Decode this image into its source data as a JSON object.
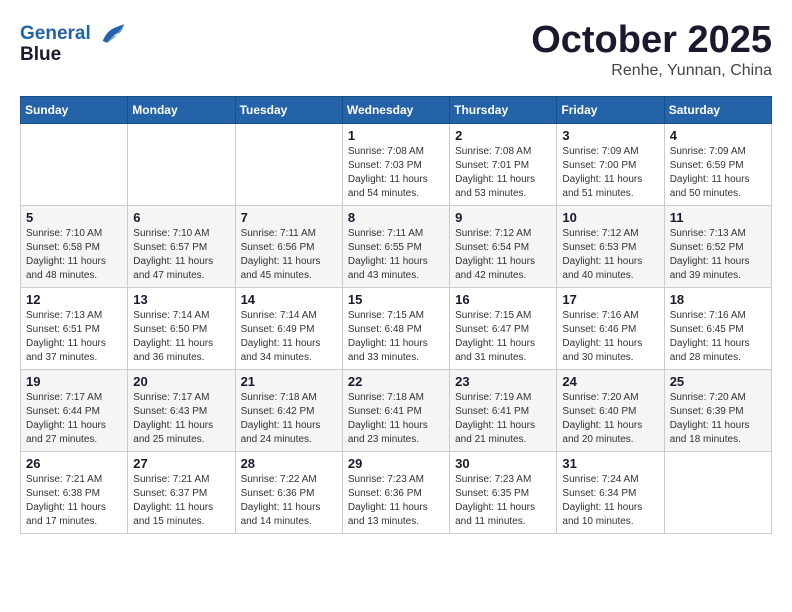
{
  "logo": {
    "line1": "General",
    "line2": "Blue"
  },
  "title": "October 2025",
  "subtitle": "Renhe, Yunnan, China",
  "weekdays": [
    "Sunday",
    "Monday",
    "Tuesday",
    "Wednesday",
    "Thursday",
    "Friday",
    "Saturday"
  ],
  "weeks": [
    [
      {
        "day": "",
        "info": ""
      },
      {
        "day": "",
        "info": ""
      },
      {
        "day": "",
        "info": ""
      },
      {
        "day": "1",
        "info": "Sunrise: 7:08 AM\nSunset: 7:03 PM\nDaylight: 11 hours\nand 54 minutes."
      },
      {
        "day": "2",
        "info": "Sunrise: 7:08 AM\nSunset: 7:01 PM\nDaylight: 11 hours\nand 53 minutes."
      },
      {
        "day": "3",
        "info": "Sunrise: 7:09 AM\nSunset: 7:00 PM\nDaylight: 11 hours\nand 51 minutes."
      },
      {
        "day": "4",
        "info": "Sunrise: 7:09 AM\nSunset: 6:59 PM\nDaylight: 11 hours\nand 50 minutes."
      }
    ],
    [
      {
        "day": "5",
        "info": "Sunrise: 7:10 AM\nSunset: 6:58 PM\nDaylight: 11 hours\nand 48 minutes."
      },
      {
        "day": "6",
        "info": "Sunrise: 7:10 AM\nSunset: 6:57 PM\nDaylight: 11 hours\nand 47 minutes."
      },
      {
        "day": "7",
        "info": "Sunrise: 7:11 AM\nSunset: 6:56 PM\nDaylight: 11 hours\nand 45 minutes."
      },
      {
        "day": "8",
        "info": "Sunrise: 7:11 AM\nSunset: 6:55 PM\nDaylight: 11 hours\nand 43 minutes."
      },
      {
        "day": "9",
        "info": "Sunrise: 7:12 AM\nSunset: 6:54 PM\nDaylight: 11 hours\nand 42 minutes."
      },
      {
        "day": "10",
        "info": "Sunrise: 7:12 AM\nSunset: 6:53 PM\nDaylight: 11 hours\nand 40 minutes."
      },
      {
        "day": "11",
        "info": "Sunrise: 7:13 AM\nSunset: 6:52 PM\nDaylight: 11 hours\nand 39 minutes."
      }
    ],
    [
      {
        "day": "12",
        "info": "Sunrise: 7:13 AM\nSunset: 6:51 PM\nDaylight: 11 hours\nand 37 minutes."
      },
      {
        "day": "13",
        "info": "Sunrise: 7:14 AM\nSunset: 6:50 PM\nDaylight: 11 hours\nand 36 minutes."
      },
      {
        "day": "14",
        "info": "Sunrise: 7:14 AM\nSunset: 6:49 PM\nDaylight: 11 hours\nand 34 minutes."
      },
      {
        "day": "15",
        "info": "Sunrise: 7:15 AM\nSunset: 6:48 PM\nDaylight: 11 hours\nand 33 minutes."
      },
      {
        "day": "16",
        "info": "Sunrise: 7:15 AM\nSunset: 6:47 PM\nDaylight: 11 hours\nand 31 minutes."
      },
      {
        "day": "17",
        "info": "Sunrise: 7:16 AM\nSunset: 6:46 PM\nDaylight: 11 hours\nand 30 minutes."
      },
      {
        "day": "18",
        "info": "Sunrise: 7:16 AM\nSunset: 6:45 PM\nDaylight: 11 hours\nand 28 minutes."
      }
    ],
    [
      {
        "day": "19",
        "info": "Sunrise: 7:17 AM\nSunset: 6:44 PM\nDaylight: 11 hours\nand 27 minutes."
      },
      {
        "day": "20",
        "info": "Sunrise: 7:17 AM\nSunset: 6:43 PM\nDaylight: 11 hours\nand 25 minutes."
      },
      {
        "day": "21",
        "info": "Sunrise: 7:18 AM\nSunset: 6:42 PM\nDaylight: 11 hours\nand 24 minutes."
      },
      {
        "day": "22",
        "info": "Sunrise: 7:18 AM\nSunset: 6:41 PM\nDaylight: 11 hours\nand 23 minutes."
      },
      {
        "day": "23",
        "info": "Sunrise: 7:19 AM\nSunset: 6:41 PM\nDaylight: 11 hours\nand 21 minutes."
      },
      {
        "day": "24",
        "info": "Sunrise: 7:20 AM\nSunset: 6:40 PM\nDaylight: 11 hours\nand 20 minutes."
      },
      {
        "day": "25",
        "info": "Sunrise: 7:20 AM\nSunset: 6:39 PM\nDaylight: 11 hours\nand 18 minutes."
      }
    ],
    [
      {
        "day": "26",
        "info": "Sunrise: 7:21 AM\nSunset: 6:38 PM\nDaylight: 11 hours\nand 17 minutes."
      },
      {
        "day": "27",
        "info": "Sunrise: 7:21 AM\nSunset: 6:37 PM\nDaylight: 11 hours\nand 15 minutes."
      },
      {
        "day": "28",
        "info": "Sunrise: 7:22 AM\nSunset: 6:36 PM\nDaylight: 11 hours\nand 14 minutes."
      },
      {
        "day": "29",
        "info": "Sunrise: 7:23 AM\nSunset: 6:36 PM\nDaylight: 11 hours\nand 13 minutes."
      },
      {
        "day": "30",
        "info": "Sunrise: 7:23 AM\nSunset: 6:35 PM\nDaylight: 11 hours\nand 11 minutes."
      },
      {
        "day": "31",
        "info": "Sunrise: 7:24 AM\nSunset: 6:34 PM\nDaylight: 11 hours\nand 10 minutes."
      },
      {
        "day": "",
        "info": ""
      }
    ]
  ]
}
